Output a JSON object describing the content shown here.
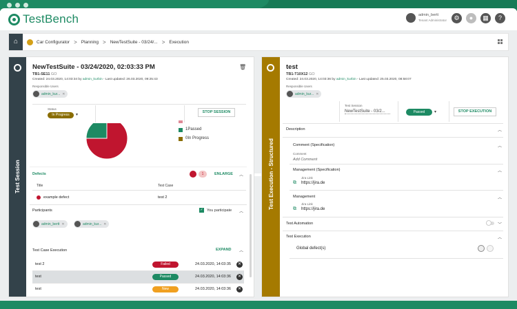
{
  "app": {
    "logo_text": "TestBench",
    "brand_color": "#1d8a63"
  },
  "header": {
    "user_name": "admin_bertt",
    "user_role": "Tenant Administrator",
    "icons": [
      "settings-icon",
      "notification-icon",
      "calendar-icon",
      "help-icon"
    ],
    "help_glyph": "?"
  },
  "breadcrumb": {
    "items": [
      "Car Configurator",
      "Planning",
      "NewTestSuite - 03/24/...",
      "Execution"
    ],
    "separator": ">"
  },
  "left": {
    "vertical_title": "Test Session",
    "title": "NewTestSuite - 03/24/2020, 02:03:33 PM",
    "id": "TB1-SE11",
    "go": "GO",
    "created_prefix": "Created: 24.03.2020, 14:03:34 by ",
    "created_by": "admin_kurbin",
    "updated": " - Last updated: 26.03.2020, 09:25:43",
    "responsible_label": "Responsible Users",
    "responsible_chip": "admin_kur...",
    "status_label": "Status",
    "status_value": "In Progress",
    "stop_button": "STOP SESSION",
    "chart_data": {
      "type": "pie",
      "series": [
        {
          "name": "Passed",
          "count": 1,
          "color": "#1d8a63"
        },
        {
          "name": "In Progress",
          "count": 0,
          "color": "#8a6d00"
        },
        {
          "name": "Failed",
          "count": 1,
          "color": "#c0152f"
        }
      ],
      "visible_fractions": {
        "failed": 0.75,
        "passed": 0.25
      },
      "legend": [
        "1Passed",
        "0In Progress"
      ],
      "legend_position": "right"
    },
    "defects": {
      "label": "Defects",
      "count_badge": "1",
      "enlarge": "ENLARGE",
      "col_title": "Title",
      "col_testcase": "Test Case",
      "rows": [
        {
          "title": "example defect",
          "testcase": "test 2"
        }
      ]
    },
    "participants": {
      "label": "Participants",
      "you_participate": "You participate",
      "chips": [
        "admin_bertt",
        "admin_kur..."
      ]
    },
    "execution": {
      "label": "Test Case Execution",
      "expand": "EXPAND",
      "rows": [
        {
          "name": "test 2",
          "status": "Failed",
          "status_color": "#c0152f",
          "time": "24.03.2020, 14:03:35"
        },
        {
          "name": "test",
          "status": "Passed",
          "status_color": "#1d8a63",
          "time": "24.03.2020, 14:03:36"
        },
        {
          "name": "test",
          "status": "New",
          "status_color": "#f0a020",
          "time": "24.03.2020, 14:03:36"
        }
      ]
    }
  },
  "right": {
    "vertical_title": "Test Execution - Structured",
    "title": "test",
    "id": "TB1-T10X12",
    "go": "GO",
    "created_prefix": "Created: 24.03.2020, 14:03:36 by ",
    "created_by": "admin_kurbin",
    "updated": " - Last updated: 25.03.2020, 08:58:07",
    "responsible_label": "Responsible Users",
    "responsible_chip": "admin_kur...",
    "session_label": "Test Session",
    "session_value": "NewTestSuite - 03/2...",
    "status_value": "Passed",
    "stop_button": "STOP EXECUTION",
    "description": "Description",
    "comment_spec": "Comment (Specification)",
    "comment_label": "Comment",
    "add_comment": "Add Comment",
    "management_spec": "Management (Specification)",
    "jira_label": "Jira Link",
    "jira_url": "https://jira.de",
    "management": "Management",
    "test_automation": "Test Automation",
    "test_execution": "Test Execution",
    "global_defects": "Global defect(s)"
  }
}
